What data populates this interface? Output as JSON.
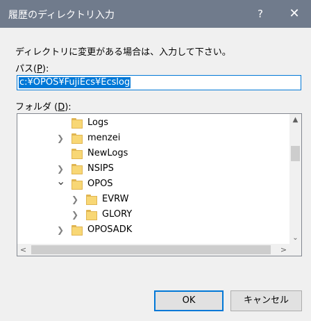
{
  "window": {
    "title": "履歴のディレクトリ入力",
    "help_label": "?",
    "close_label": "✕"
  },
  "instruction": "ディレクトリに変更がある場合は、入力して下さい。",
  "path": {
    "label_prefix": "パス(",
    "label_key": "P",
    "label_suffix": "):",
    "value": "c:¥OPOS¥FujiEcs¥Ecslog"
  },
  "folder": {
    "label_prefix": "フォルダ (",
    "label_key": "D",
    "label_suffix": "):"
  },
  "tree": {
    "items": [
      {
        "name": "Logs",
        "expander": "",
        "level": 0
      },
      {
        "name": "menzei",
        "expander": "collapsed",
        "level": 0
      },
      {
        "name": "NewLogs",
        "expander": "",
        "level": 0
      },
      {
        "name": "NSIPS",
        "expander": "collapsed",
        "level": 0
      },
      {
        "name": "OPOS",
        "expander": "expanded",
        "level": 0
      },
      {
        "name": "EVRW",
        "expander": "collapsed",
        "level": 1
      },
      {
        "name": "GLORY",
        "expander": "collapsed",
        "level": 1
      },
      {
        "name": "OPOSADK",
        "expander": "collapsed",
        "level": 0
      }
    ],
    "glyph_collapsed": "❯",
    "glyph_expanded": "⌄"
  },
  "scrollbars": {
    "up": "▲",
    "down": "⌄",
    "left": "<",
    "right": ">"
  },
  "buttons": {
    "ok_label": "OK",
    "cancel_label": "キャンセル"
  },
  "colors": {
    "titlebar": "#707b8c",
    "selection": "#0078d7",
    "folder": "#f8d775"
  }
}
